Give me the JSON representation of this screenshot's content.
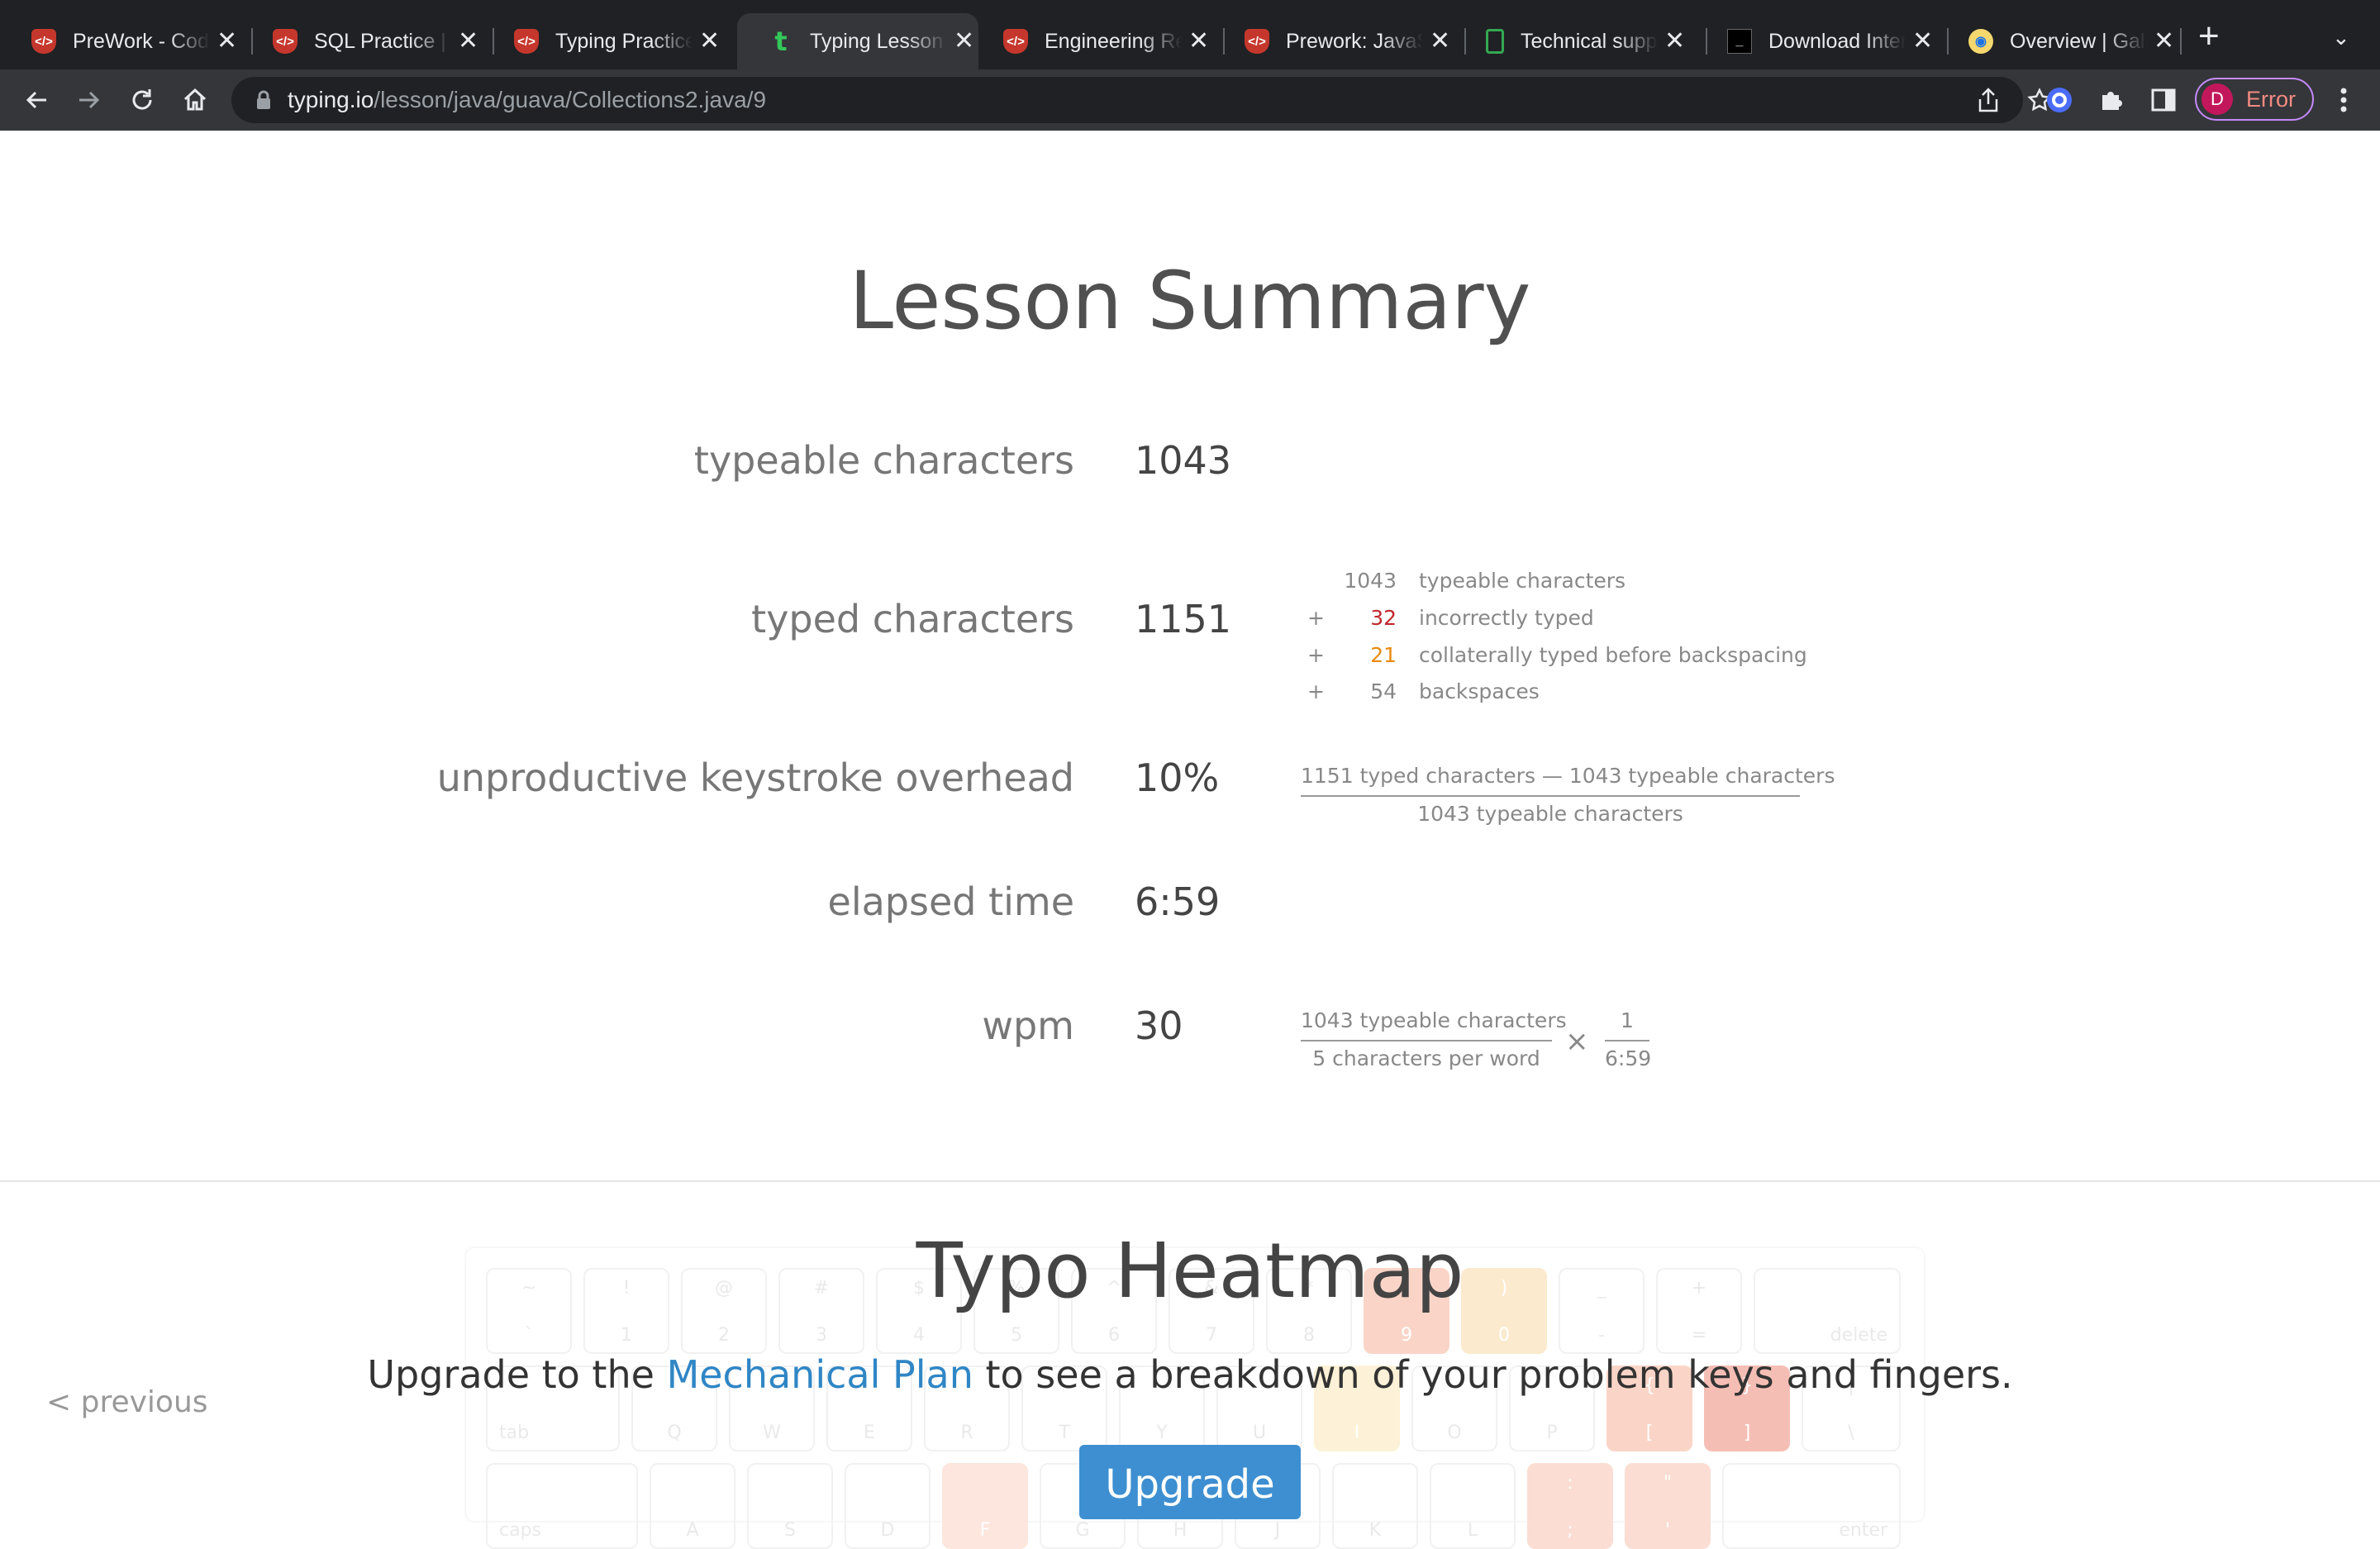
{
  "browser": {
    "tabs": [
      {
        "title": "PreWork - Coding",
        "icon": "shield-code-icon",
        "active": false
      },
      {
        "title": "SQL Practice | Coding",
        "icon": "shield-code-icon",
        "active": false
      },
      {
        "title": "Typing Practice",
        "icon": "shield-code-icon",
        "active": false
      },
      {
        "title": "Typing Lesson",
        "icon": "typing-io-icon",
        "active": true
      },
      {
        "title": "Engineering Resources",
        "icon": "shield-code-icon",
        "active": false
      },
      {
        "title": "Prework: JavaScript",
        "icon": "shield-code-icon",
        "active": false
      },
      {
        "title": "Technical support",
        "icon": "doc-icon",
        "active": false
      },
      {
        "title": "Download Interview",
        "icon": "terminal-icon",
        "active": false
      },
      {
        "title": "Overview | Gallery",
        "icon": "globe-icon",
        "active": false
      }
    ],
    "new_tab_symbol": "+",
    "close_symbol": "✕",
    "url_domain": "typing.io",
    "url_path": "/lesson/java/guava/Collections2.java/9",
    "profile_initial": "D",
    "profile_status": "Error"
  },
  "page": {
    "title": "Lesson Summary",
    "stats": {
      "typeable_label": "typeable characters",
      "typeable_value": "1043",
      "typed_label": "typed characters",
      "typed_value": "1151",
      "overhead_label": "unproductive keystroke overhead",
      "overhead_value": "10%",
      "elapsed_label": "elapsed time",
      "elapsed_value": "6:59",
      "wpm_label": "wpm",
      "wpm_value": "30"
    },
    "typed_breakdown": [
      {
        "op": "",
        "value": "1043",
        "label": "typeable characters",
        "color": "#888888"
      },
      {
        "op": "+",
        "value": "32",
        "label": "incorrectly typed",
        "color": "#c1272d"
      },
      {
        "op": "+",
        "value": "21",
        "label": "collaterally typed before backspacing",
        "color": "#e88a0c"
      },
      {
        "op": "+",
        "value": "54",
        "label": "backspaces",
        "color": "#888888"
      }
    ],
    "overhead_formula": {
      "numerator": "1151 typed characters — 1043 typeable characters",
      "denominator": "1043 typeable characters"
    },
    "wpm_formula": {
      "numerator": "1043 typeable characters",
      "denominator": "5 characters per word",
      "times": "×",
      "numerator2": "1",
      "denominator2": "6:59"
    },
    "heatmap": {
      "title": "Typo Heatmap",
      "upgrade_before": "Upgrade to the ",
      "upgrade_link": "Mechanical Plan",
      "upgrade_after": " to see a breakdown of your problem keys and fingers.",
      "upgrade_button": "Upgrade",
      "keyboard_rows": [
        [
          [
            "~",
            "`"
          ],
          [
            "!",
            "1"
          ],
          [
            "@",
            "2"
          ],
          [
            "#",
            "3"
          ],
          [
            "$",
            "4"
          ],
          [
            "%",
            "5"
          ],
          [
            "^",
            "6"
          ],
          [
            "&",
            "7"
          ],
          [
            "*",
            "8"
          ],
          [
            "(",
            "9"
          ],
          [
            ")",
            "0"
          ],
          [
            "_",
            "-"
          ],
          [
            "+",
            "="
          ],
          [
            "",
            "delete"
          ]
        ],
        [
          [
            "",
            "tab"
          ],
          [
            "",
            "Q"
          ],
          [
            "",
            "W"
          ],
          [
            "",
            "E"
          ],
          [
            "",
            "R"
          ],
          [
            "",
            "T"
          ],
          [
            "",
            "Y"
          ],
          [
            "",
            "U"
          ],
          [
            "",
            "I"
          ],
          [
            "",
            "O"
          ],
          [
            "",
            "P"
          ],
          [
            "{",
            "["
          ],
          [
            "}",
            "]"
          ],
          [
            "|",
            "\\"
          ]
        ],
        [
          [
            "",
            "caps"
          ],
          [
            "",
            "A"
          ],
          [
            "",
            "S"
          ],
          [
            "",
            "D"
          ],
          [
            "",
            "F"
          ],
          [
            "",
            "G"
          ],
          [
            "",
            "H"
          ],
          [
            "",
            "J"
          ],
          [
            "",
            "K"
          ],
          [
            "",
            "L"
          ],
          [
            ":",
            ";"
          ],
          [
            "\"",
            "'"
          ],
          [
            "",
            "enter"
          ]
        ]
      ]
    },
    "previous_link": "< previous"
  }
}
